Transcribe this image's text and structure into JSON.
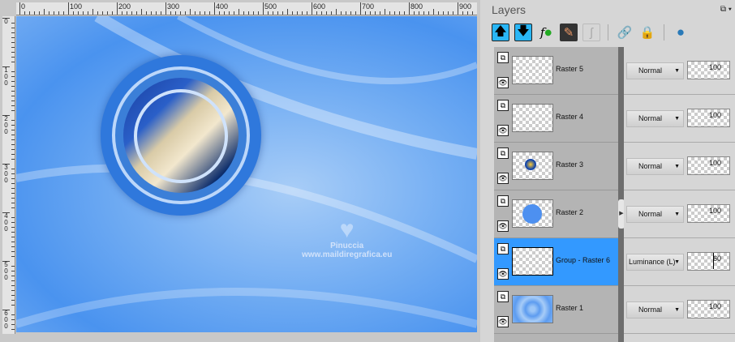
{
  "ruler": {
    "h_labels": [
      "0",
      "100",
      "200",
      "300",
      "400",
      "500",
      "600",
      "700",
      "800",
      "900"
    ],
    "v_labels": [
      "0",
      "100",
      "200",
      "300",
      "400",
      "500",
      "600"
    ]
  },
  "watermark": {
    "line1": "Pinuccia",
    "line2": "www.maildiregrafica.eu"
  },
  "panel": {
    "title": "Layers",
    "restore_icon": "restore-icon",
    "menu_icon": "dropdown-icon"
  },
  "toolbar": [
    {
      "icon": "move-layer-up-icon"
    },
    {
      "icon": "move-layer-down-icon"
    },
    {
      "icon": "layer-effects-visibility-icon"
    },
    {
      "icon": "edit-layer-icon"
    },
    {
      "icon": "fx-disabled-icon"
    },
    {
      "icon": "link-icon"
    },
    {
      "icon": "lock-icon"
    },
    {
      "icon": "new-layer-icon"
    }
  ],
  "layers": [
    {
      "name": "Raster 5",
      "blend": "Normal",
      "opacity": "100",
      "selected": false
    },
    {
      "name": "Raster 4",
      "blend": "Normal",
      "opacity": "100",
      "selected": false
    },
    {
      "name": "Raster 3",
      "blend": "Normal",
      "opacity": "100",
      "selected": false
    },
    {
      "name": "Raster 2",
      "blend": "Normal",
      "opacity": "100",
      "selected": false
    },
    {
      "name": "Group - Raster 6",
      "blend": "Luminance (L)",
      "opacity": "60",
      "selected": true
    },
    {
      "name": "Raster 1",
      "blend": "Normal",
      "opacity": "100",
      "selected": false
    }
  ]
}
